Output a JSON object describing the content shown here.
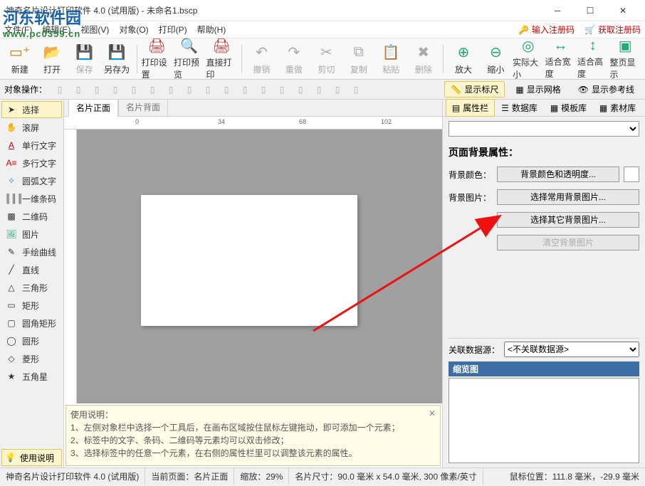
{
  "window": {
    "title": "神奇名片设计打印软件 4.0 (试用版) - 未命名1.bscp"
  },
  "watermark": {
    "name": "河东软件园",
    "url": "www.pc0359.cn"
  },
  "menu": {
    "file": "文件(F)",
    "edit": "编辑(E)",
    "view": "视图(V)",
    "object": "对象(O)",
    "print": "打印(P)",
    "help": "帮助(H)",
    "enter_reg": "输入注册码",
    "get_reg": "获取注册码"
  },
  "toolbar": {
    "new": "新建",
    "open": "打开",
    "save": "保存",
    "saveas": "另存为",
    "printset": "打印设置",
    "preview": "打印预览",
    "print": "直接打印",
    "undo": "撤销",
    "redo": "重做",
    "cut": "剪切",
    "copy": "复制",
    "paste": "粘贴",
    "delete": "删除",
    "zoomin": "放大",
    "zoomout": "缩小",
    "actual": "实际大小",
    "fitw": "适合宽度",
    "fith": "适合高度",
    "fitpage": "整页显示"
  },
  "opsbar": {
    "label": "对象操作：",
    "show_ruler": "显示标尺",
    "show_grid": "显示网格",
    "show_guides": "显示参考线"
  },
  "tools": {
    "select": "选择",
    "pan": "滚屏",
    "text1": "单行文字",
    "textm": "多行文字",
    "arc": "圆弧文字",
    "barcode": "一维条码",
    "qrcode": "二维码",
    "image": "图片",
    "freehand": "手绘曲线",
    "line": "直线",
    "triangle": "三角形",
    "rect": "矩形",
    "roundrect": "圆角矩形",
    "ellipse": "圆形",
    "diamond": "菱形",
    "star": "五角星",
    "help_btn": "使用说明"
  },
  "card_tabs": {
    "front": "名片正面",
    "back": "名片背面"
  },
  "ruler_ticks": [
    "0",
    "34",
    "68",
    "102"
  ],
  "help_box": {
    "title": "使用说明：",
    "l1": "1、左侧对象栏中选择一个工具后，在画布区域按住鼠标左键拖动，即可添加一个元素；",
    "l2": "2、标签中的文字、条码、二维码等元素均可以双击修改；",
    "l3": "3、选择标签中的任意一个元素，在右侧的属性栏里可以调整该元素的属性。"
  },
  "prop_tabs": {
    "props": "属性栏",
    "db": "数据库",
    "tpl": "模板库",
    "assets": "素材库"
  },
  "props": {
    "section_title": "页面背景属性：",
    "bg_color": "背景颜色：",
    "bg_color_btn": "背景颜色和透明度...",
    "bg_image": "背景图片：",
    "bg_img_common": "选择常用背景图片...",
    "bg_img_other": "选择其它背景图片...",
    "bg_clear": "清空背景图片",
    "ds_label": "关联数据源：",
    "ds_value": "<不关联数据源>",
    "thumb": "缩览图"
  },
  "status": {
    "app": "神奇名片设计打印软件 4.0 (试用版)",
    "page": "当前页面：名片正面",
    "zoom": "缩放：29%",
    "size": "名片尺寸：90.0 毫米 x 54.0 毫米, 300 像素/英寸",
    "mouse": "鼠标位置：111.8 毫米，-29.9 毫米"
  }
}
